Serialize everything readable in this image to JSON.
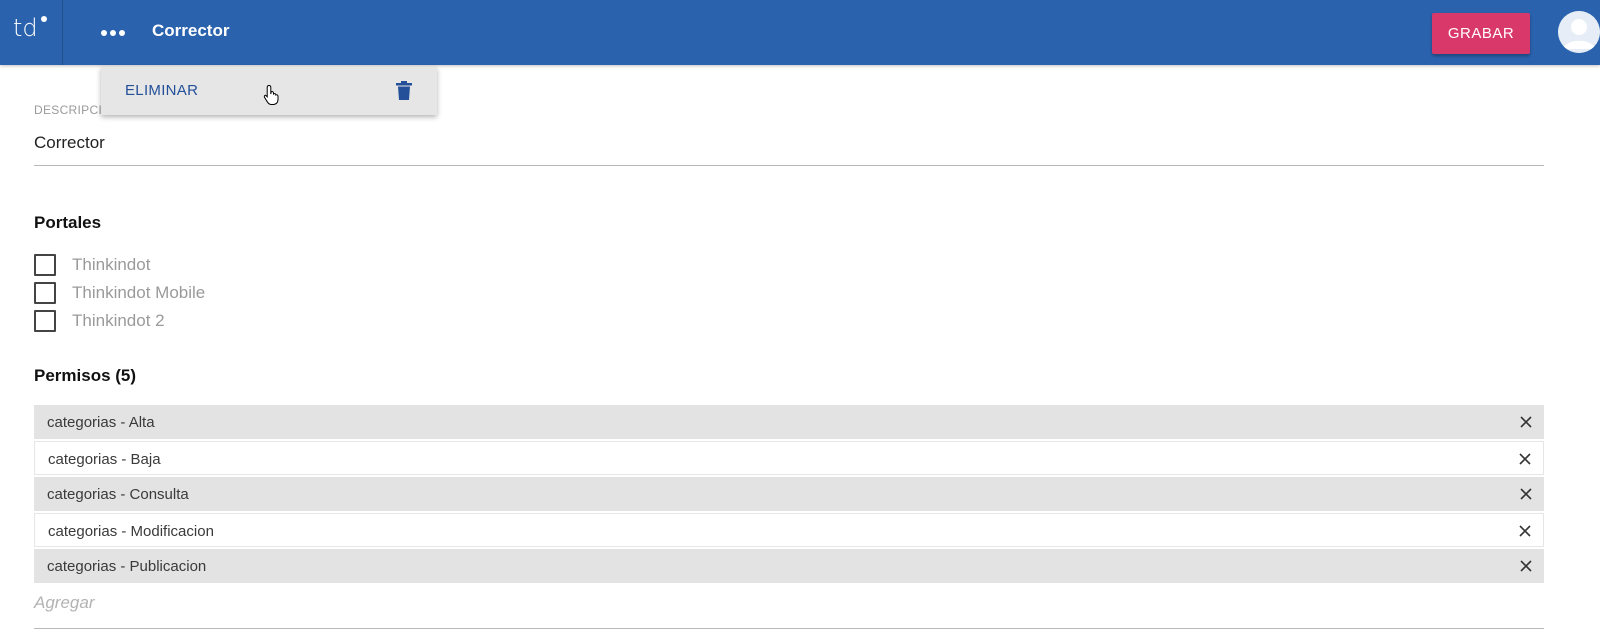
{
  "header": {
    "logo_text": "td",
    "title": "Corrector",
    "save_label": "GRABAR",
    "more_icon": "more-horizontal-icon",
    "avatar_icon": "user-avatar-icon",
    "bg_color": "#2b62ad",
    "save_color": "#d9386b"
  },
  "menu": {
    "item_label": "ELIMINAR",
    "item_icon": "trash-icon"
  },
  "form": {
    "description_label": "DESCRIPCIÓN",
    "description_value": "Corrector"
  },
  "portales": {
    "title": "Portales",
    "items": [
      {
        "label": "Thinkindot",
        "checked": false
      },
      {
        "label": "Thinkindot Mobile",
        "checked": false
      },
      {
        "label": "Thinkindot 2",
        "checked": false
      }
    ]
  },
  "permisos": {
    "title": "Permisos (5)",
    "items": [
      {
        "label": "categorias - Alta"
      },
      {
        "label": "categorias - Baja"
      },
      {
        "label": "categorias - Consulta"
      },
      {
        "label": "categorias - Modificacion"
      },
      {
        "label": "categorias - Publicacion"
      }
    ],
    "add_placeholder": "Agregar"
  }
}
